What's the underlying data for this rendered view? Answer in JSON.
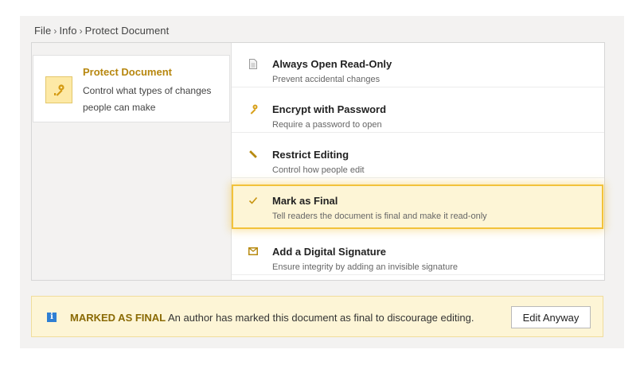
{
  "breadcrumb": {
    "items": [
      "File",
      "Info",
      "Protect Document"
    ],
    "separator": "›"
  },
  "protect": {
    "title": "Protect Document",
    "description": "Control what types of changes people can make",
    "icon": "key-icon"
  },
  "options": [
    {
      "icon": "document-icon",
      "title": "Always Open Read-Only",
      "description": "Prevent accidental changes",
      "selected": false
    },
    {
      "icon": "key-icon",
      "title": "Encrypt with Password",
      "description": "Require a password to open",
      "selected": false
    },
    {
      "icon": "pencil-icon",
      "title": "Restrict Editing",
      "description": "Control how people edit",
      "selected": false
    },
    {
      "icon": "checkmark-icon",
      "title": "Mark as Final",
      "description": "Tell readers the document is final and make it read-only",
      "selected": true
    },
    {
      "icon": "envelope-icon",
      "title": "Add a Digital Signature",
      "description": "Ensure integrity by adding an invisible signature",
      "selected": false
    }
  ],
  "banner": {
    "icon": "info-icon",
    "label": "MARKED AS FINAL",
    "message": "An author has marked this document as final to discourage editing.",
    "button_label": "Edit Anyway"
  },
  "colors": {
    "accent": "#b7870f",
    "selection_border": "#f2c23a",
    "selection_fill": "#fdf5d6",
    "info_blue": "#2f7fd3"
  }
}
